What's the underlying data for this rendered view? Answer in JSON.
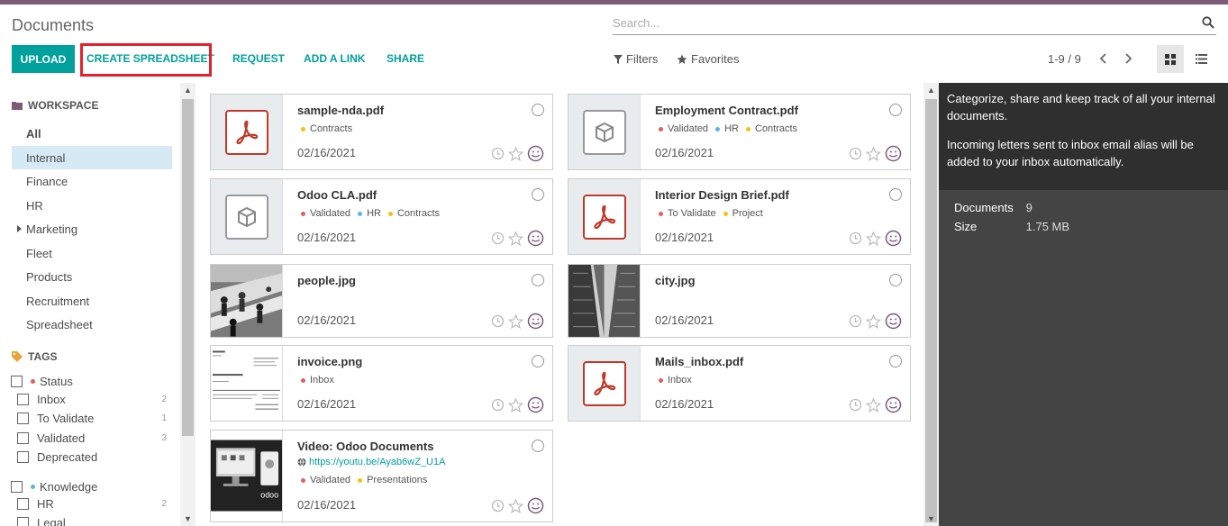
{
  "app": {
    "title": "Documents"
  },
  "search": {
    "placeholder": "Search..."
  },
  "toolbar": {
    "upload": "UPLOAD",
    "create_spreadsheet": "CREATE SPREADSHEET",
    "request": "REQUEST",
    "add_link": "ADD A LINK",
    "share": "SHARE",
    "filters": "Filters",
    "favorites": "Favorites",
    "pager": "1-9 / 9"
  },
  "colors": {
    "accent": "#00a09d",
    "highlight": "#e4202e",
    "topbar": "#7c5a78"
  },
  "workspace": {
    "title": "WORKSPACE",
    "items": [
      "All",
      "Internal",
      "Finance",
      "HR",
      "Marketing",
      "Fleet",
      "Products",
      "Recruitment",
      "Spreadsheet"
    ],
    "selected": "Internal"
  },
  "tags": {
    "title": "TAGS",
    "groups": [
      {
        "name": "Status",
        "color": "#e35d5d",
        "items": [
          {
            "label": "Inbox",
            "count": "2"
          },
          {
            "label": "To Validate",
            "count": "1"
          },
          {
            "label": "Validated",
            "count": "3"
          },
          {
            "label": "Deprecated",
            "count": ""
          }
        ]
      },
      {
        "name": "Knowledge",
        "color": "#5fb3e4",
        "items": [
          {
            "label": "HR",
            "count": "2"
          },
          {
            "label": "Legal",
            "count": ""
          }
        ]
      }
    ]
  },
  "documents": [
    {
      "name": "sample-nda.pdf",
      "tags": [
        {
          "label": "Contracts",
          "color": "#f1c40f"
        }
      ],
      "date": "02/16/2021",
      "thumb": "pdf"
    },
    {
      "name": "Employment Contract.pdf",
      "tags": [
        {
          "label": "Validated",
          "color": "#e35d5d"
        },
        {
          "label": "HR",
          "color": "#5fb3e4"
        },
        {
          "label": "Contracts",
          "color": "#f1c40f"
        }
      ],
      "date": "02/16/2021",
      "thumb": "box"
    },
    {
      "name": "Odoo CLA.pdf",
      "tags": [
        {
          "label": "Validated",
          "color": "#e35d5d"
        },
        {
          "label": "HR",
          "color": "#5fb3e4"
        },
        {
          "label": "Contracts",
          "color": "#f1c40f"
        }
      ],
      "date": "02/16/2021",
      "thumb": "box"
    },
    {
      "name": "Interior Design Brief.pdf",
      "tags": [
        {
          "label": "To Validate",
          "color": "#e35d5d"
        },
        {
          "label": "Project",
          "color": "#f1c40f"
        }
      ],
      "date": "02/16/2021",
      "thumb": "pdf"
    },
    {
      "name": "people.jpg",
      "tags": [],
      "date": "02/16/2021",
      "thumb": "photo-people"
    },
    {
      "name": "city.jpg",
      "tags": [],
      "date": "02/16/2021",
      "thumb": "photo-city"
    },
    {
      "name": "invoice.png",
      "tags": [
        {
          "label": "Inbox",
          "color": "#e35d5d"
        }
      ],
      "date": "02/16/2021",
      "thumb": "invoice"
    },
    {
      "name": "Mails_inbox.pdf",
      "tags": [
        {
          "label": "Inbox",
          "color": "#e35d5d"
        }
      ],
      "date": "02/16/2021",
      "thumb": "pdf"
    },
    {
      "name": "Video: Odoo Documents",
      "url": "https://youtu.be/Ayab6wZ_U1A",
      "tags": [
        {
          "label": "Validated",
          "color": "#e35d5d"
        },
        {
          "label": "Presentations",
          "color": "#f1c40f"
        }
      ],
      "date": "02/16/2021",
      "thumb": "video"
    }
  ],
  "info": {
    "desc1": "Categorize, share and keep track of all your internal documents.",
    "desc2": "Incoming letters sent to inbox email alias will be added to your inbox automatically.",
    "documents_label": "Documents",
    "documents_value": "9",
    "size_label": "Size",
    "size_value": "1.75 MB"
  }
}
